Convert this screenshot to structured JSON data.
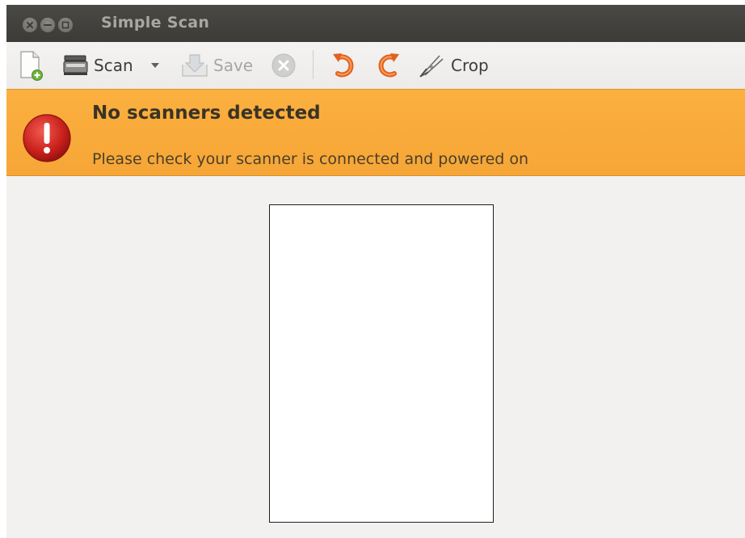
{
  "window": {
    "title": "Simple Scan"
  },
  "toolbar": {
    "new_icon": "new-document-icon",
    "scan_label": "Scan",
    "save_label": "Save",
    "crop_label": "Crop"
  },
  "infobar": {
    "title": "No scanners detected",
    "message": "Please check your scanner is connected and powered on",
    "background": "#f9ab3b"
  }
}
